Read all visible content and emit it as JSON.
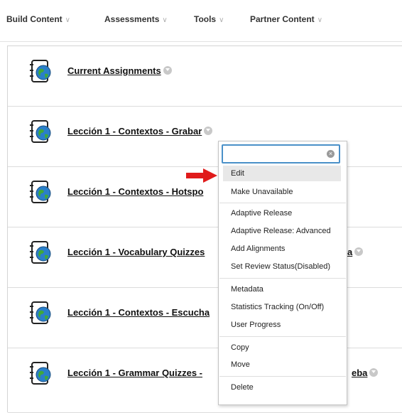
{
  "toolbar": {
    "items": [
      {
        "label": "Build Content"
      },
      {
        "label": "Assessments"
      },
      {
        "label": "Tools"
      },
      {
        "label": "Partner Content"
      }
    ]
  },
  "content_items": [
    {
      "title": "Current Assignments",
      "icon": "assignment-globe-icon"
    },
    {
      "title": "Lección 1 - Contextos - Grabar",
      "icon": "assignment-globe-icon"
    },
    {
      "title": "Lección 1 - Contextos - Hotspo",
      "icon": "assignment-globe-icon"
    },
    {
      "title": "Lección 1 - Vocabulary Quizzes",
      "title_tail": "a",
      "icon": "assignment-globe-icon"
    },
    {
      "title": "Lección 1 - Contextos - Escucha",
      "icon": "assignment-globe-icon"
    },
    {
      "title": "Lección 1 - Grammar Quizzes -",
      "title_tail": "eba",
      "icon": "assignment-globe-icon"
    }
  ],
  "context_menu": {
    "search_value": "",
    "items": {
      "edit": "Edit",
      "make_unavailable": "Make Unavailable",
      "adaptive_release": "Adaptive Release",
      "adaptive_release_advanced": "Adaptive Release: Advanced",
      "add_alignments": "Add Alignments",
      "set_review_status": "Set Review Status(Disabled)",
      "metadata": "Metadata",
      "statistics_tracking": "Statistics Tracking (On/Off)",
      "user_progress": "User Progress",
      "copy": "Copy",
      "move": "Move",
      "delete": "Delete"
    },
    "highlighted": "Edit"
  },
  "colors": {
    "annotation_arrow": "#e01b1b",
    "search_focus": "#4a90c8",
    "highlight": "#e8e8e8"
  }
}
